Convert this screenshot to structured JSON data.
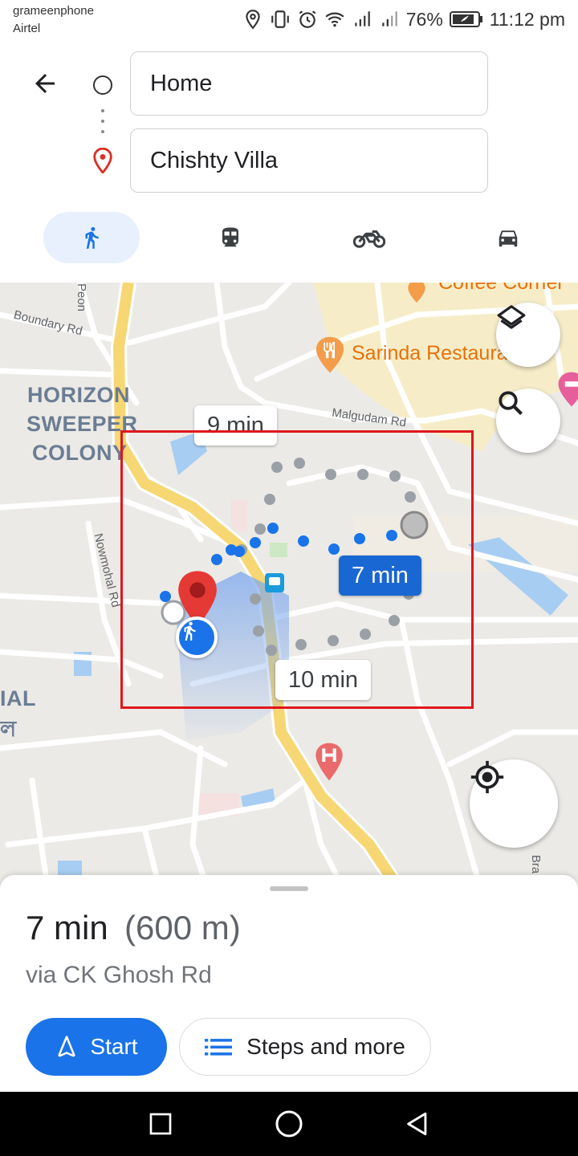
{
  "status_bar": {
    "carrier_primary": "grameenphone",
    "carrier_secondary": "Airtel",
    "battery": "76%",
    "time": "11:12 pm",
    "icons": [
      "location-icon",
      "vibrate-icon",
      "alarm-icon",
      "wifi-icon",
      "signal-icon",
      "signal-icon",
      "battery-icon"
    ]
  },
  "directions": {
    "origin": "Home",
    "destination": "Chishty Villa",
    "modes": [
      {
        "name": "walk",
        "icon": "walk-icon",
        "selected": true
      },
      {
        "name": "transit",
        "icon": "transit-icon",
        "selected": false
      },
      {
        "name": "two-wheeler",
        "icon": "motorcycle-icon",
        "selected": false
      },
      {
        "name": "drive",
        "icon": "car-icon",
        "selected": false
      }
    ]
  },
  "map": {
    "area_labels": [
      "HORIZON",
      "SWEEPER",
      "COLONY",
      "IAL",
      "ল"
    ],
    "road_labels": [
      "Boundary Rd",
      "Malgudam Rd",
      "Nowmohal Rd",
      "Peon",
      "Bra"
    ],
    "poi_labels": [
      "Sarinda Restaura",
      "Coffee Corner"
    ],
    "route_times": {
      "alt_top": "9 min",
      "main": "7 min",
      "alt_bottom": "10 min"
    },
    "route_color": "#1a73e8",
    "alt_route_color": "#9aa0a6"
  },
  "summary": {
    "duration": "7 min",
    "distance": "(600 m)",
    "via": "via CK Ghosh Rd",
    "start_label": "Start",
    "steps_label": "Steps and more"
  }
}
